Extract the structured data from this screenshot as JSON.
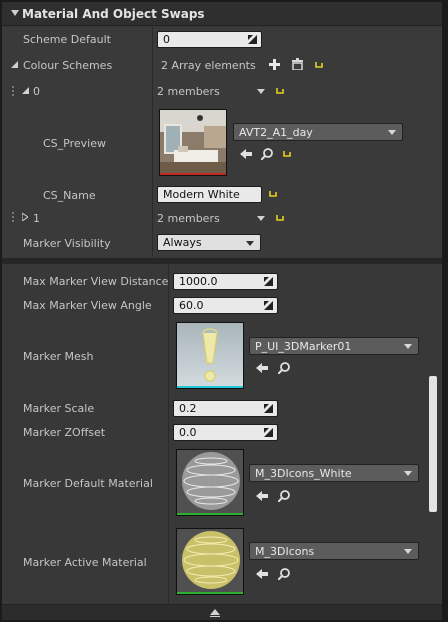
{
  "header": {
    "title": "Material And Object Swaps"
  },
  "scheme_default": {
    "label": "Scheme Default",
    "value": "0"
  },
  "colour_schemes": {
    "label": "Colour Schemes",
    "count": "2 Array elements",
    "items": [
      {
        "index": "0",
        "members": "2 members",
        "preview_label": "CS_Preview",
        "preview_asset": "AVT2_A1_day",
        "name_label": "CS_Name",
        "name_value": "Modern White"
      },
      {
        "index": "1",
        "members": "2 members"
      }
    ]
  },
  "marker_visibility": {
    "label": "Marker Visibility",
    "value": "Always"
  },
  "max_marker_view_distance": {
    "label": "Max Marker View Distance",
    "value": "1000.0"
  },
  "max_marker_view_angle": {
    "label": "Max Marker View Angle",
    "value": "60.0"
  },
  "marker_mesh": {
    "label": "Marker Mesh",
    "asset": "P_UI_3DMarker01"
  },
  "marker_scale": {
    "label": "Marker Scale",
    "value": "0.2"
  },
  "marker_zoffset": {
    "label": "Marker ZOffset",
    "value": "0.0"
  },
  "marker_default_material": {
    "label": "Marker Default Material",
    "asset": "M_3DIcons_White"
  },
  "marker_active_material": {
    "label": "Marker Active Material",
    "asset": "M_3DIcons"
  },
  "colors": {
    "reset": "#e4d020",
    "accent_cyan": "#22c8d8",
    "accent_green": "#2db02d",
    "accent_red": "#c02828"
  }
}
